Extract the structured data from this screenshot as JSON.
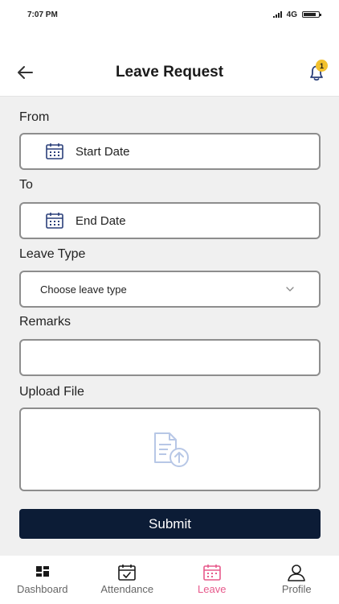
{
  "status_bar": {
    "time": "7:07 PM",
    "network": "4G",
    "battery_level": 0.85
  },
  "header": {
    "title": "Leave Request",
    "notification_count": "1"
  },
  "form": {
    "from_label": "From",
    "from_value": "Start Date",
    "to_label": "To",
    "to_value": "End Date",
    "leave_type_label": "Leave Type",
    "leave_type_value": "Choose leave type",
    "remarks_label": "Remarks",
    "remarks_value": "",
    "upload_label": "Upload File",
    "submit_label": "Submit"
  },
  "bottom_nav": {
    "items": [
      {
        "label": "Dashboard",
        "icon": "dashboard-icon"
      },
      {
        "label": "Attendance",
        "icon": "calendar-check-icon"
      },
      {
        "label": "Leave",
        "icon": "calendar-icon"
      },
      {
        "label": "Profile",
        "icon": "user-icon"
      }
    ],
    "active_index": 2
  },
  "colors": {
    "primary": "#0c1c36",
    "active_tab": "#e75a8c",
    "badge": "#f2c12e",
    "upload_icon": "#b7c7e6"
  }
}
